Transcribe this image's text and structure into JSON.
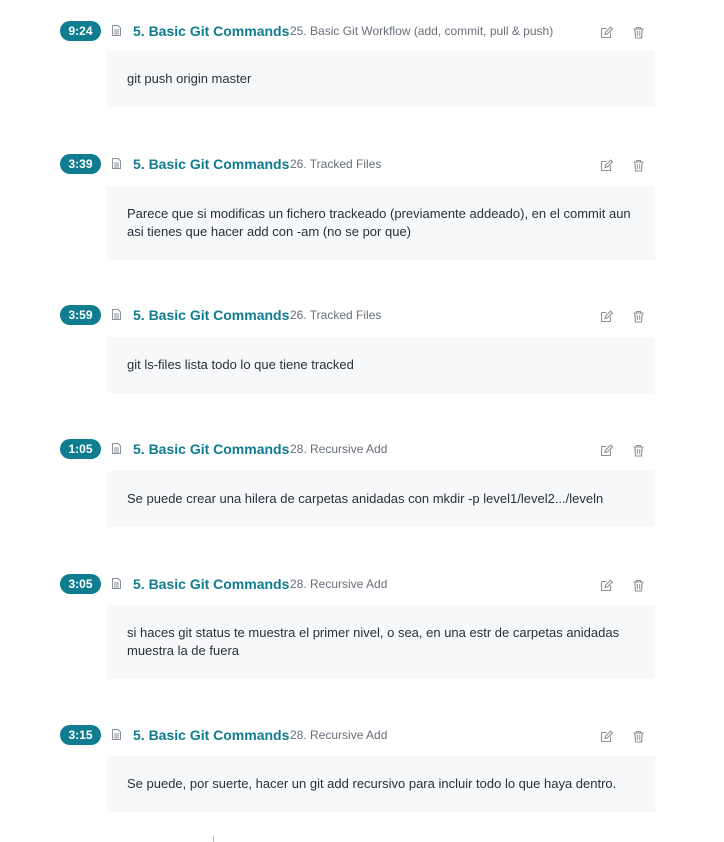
{
  "notes": [
    {
      "timestamp": "9:24",
      "section": "5. Basic Git Commands",
      "lecture": "25. Basic Git Workflow (add, commit, pull & push)",
      "body": "git push origin master"
    },
    {
      "timestamp": "3:39",
      "section": "5. Basic Git Commands",
      "lecture": "26. Tracked Files",
      "body": "Parece que si modificas un fichero trackeado (previamente addeado), en el commit aun asi tienes que hacer add con -am (no se por que)"
    },
    {
      "timestamp": "3:59",
      "section": "5. Basic Git Commands",
      "lecture": "26. Tracked Files",
      "body": "git ls-files lista todo lo que tiene tracked"
    },
    {
      "timestamp": "1:05",
      "section": "5. Basic Git Commands",
      "lecture": "28. Recursive Add",
      "body": "Se puede crear una hilera de carpetas anidadas con mkdir -p level1/level2.../leveln"
    },
    {
      "timestamp": "3:05",
      "section": "5. Basic Git Commands",
      "lecture": "28. Recursive Add",
      "body": "si haces git status te muestra el primer nivel, o sea, en una estr de carpetas anidadas muestra la de fuera"
    },
    {
      "timestamp": "3:15",
      "section": "5. Basic Git Commands",
      "lecture": "28. Recursive Add",
      "body": "Se puede, por suerte, hacer un git add recursivo para incluir todo lo que haya dentro."
    }
  ],
  "icons": {
    "doc": "file-text-icon",
    "edit": "edit-icon",
    "delete": "trash-icon"
  },
  "colors": {
    "accent": "#0f7c90",
    "body_bg": "#f7f8fa",
    "muted_text": "#686f7a"
  }
}
